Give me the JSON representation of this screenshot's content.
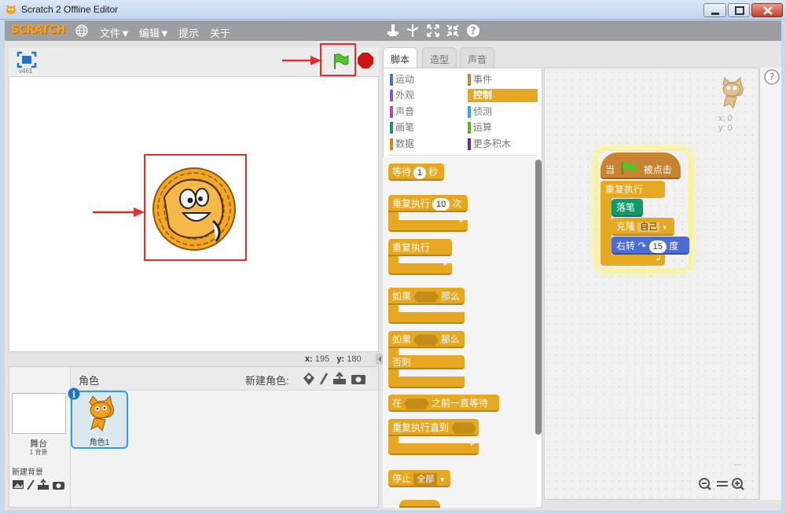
{
  "window": {
    "title": "Scratch 2 Offline Editor"
  },
  "menubar": {
    "logo": "SCRATCH",
    "items": [
      {
        "label": "文件▼"
      },
      {
        "label": "编辑▼"
      },
      {
        "label": "提示"
      },
      {
        "label": "关于"
      }
    ]
  },
  "stage": {
    "version": "v461",
    "coords": {
      "x_label": "x:",
      "x_value": "195",
      "y_label": "y:",
      "y_value": "180"
    }
  },
  "sprites": {
    "header": "角色",
    "new_sprite_label": "新建角色:",
    "stage_label": "舞台",
    "backdrop_count": "1 背景",
    "new_backdrop_label": "新建背景",
    "items": [
      {
        "name": "角色1"
      }
    ]
  },
  "tabs": [
    {
      "label": "脚本",
      "active": true
    },
    {
      "label": "造型",
      "active": false
    },
    {
      "label": "声音",
      "active": false
    }
  ],
  "categories": [
    {
      "label": "运动",
      "color": "#4a6cd4"
    },
    {
      "label": "事件",
      "color": "#c88330"
    },
    {
      "label": "外观",
      "color": "#8a55d7"
    },
    {
      "label": "控制",
      "color": "#e6a822",
      "selected": true
    },
    {
      "label": "声音",
      "color": "#bb42c3"
    },
    {
      "label": "侦测",
      "color": "#2ca5e2"
    },
    {
      "label": "画笔",
      "color": "#0e9a6c"
    },
    {
      "label": "运算",
      "color": "#5cb712"
    },
    {
      "label": "数据",
      "color": "#ee7d16"
    },
    {
      "label": "更多积木",
      "color": "#632d99"
    }
  ],
  "palette_blocks": {
    "wait": {
      "label": "等待",
      "value": "1",
      "suffix": "秒"
    },
    "repeat": {
      "label": "重复执行",
      "value": "10",
      "suffix": "次"
    },
    "forever": {
      "label": "重复执行"
    },
    "if": {
      "label": "如果",
      "suffix": "那么"
    },
    "if_else": {
      "label": "如果",
      "suffix": "那么",
      "else": "否则"
    },
    "wait_until": {
      "prefix": "在",
      "suffix": "之前一直等待"
    },
    "repeat_until": {
      "label": "重复执行直到"
    },
    "stop": {
      "label": "停止",
      "option": "全部"
    }
  },
  "script": {
    "hat": {
      "prefix": "当",
      "suffix": "被点击"
    },
    "forever": "重复执行",
    "pen_down": "落笔",
    "clone": {
      "label": "克隆",
      "option": "自己"
    },
    "turn": {
      "label": "右转",
      "value": "15",
      "suffix": "度"
    }
  },
  "sprite_info": {
    "x": "x: 0",
    "y": "y: 0"
  },
  "colors": {
    "control": "#e6a822",
    "pen": "#0e9a6c",
    "motion": "#4a6cd4",
    "annotation": "#e02d2d"
  }
}
